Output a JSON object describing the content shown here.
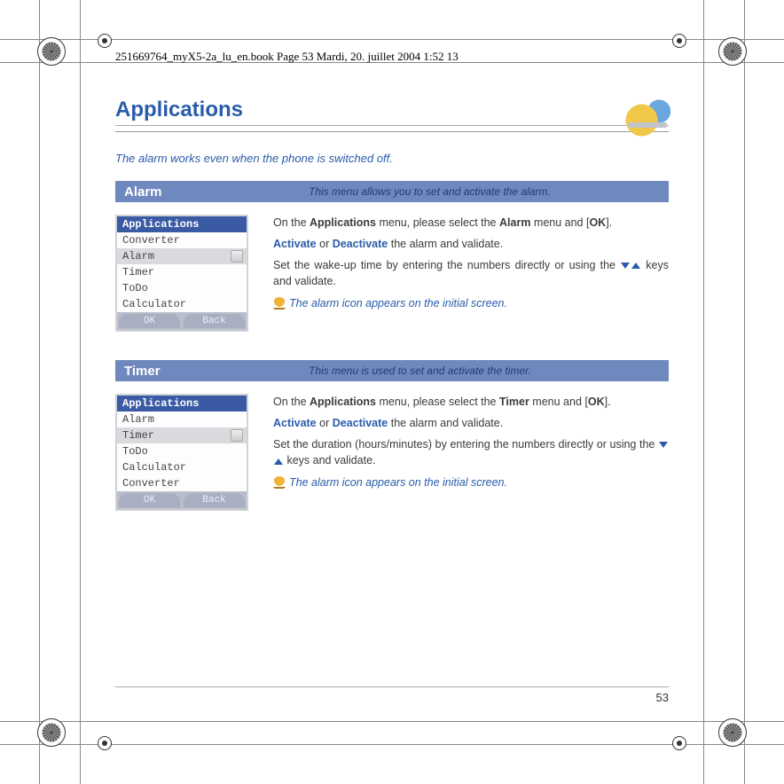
{
  "book_stamp": "251669764_myX5-2a_lu_en.book  Page 53  Mardi, 20. juillet 2004  1:52 13",
  "title": "Applications",
  "intro": "The alarm works even when the phone is switched off.",
  "page_number": "53",
  "sections": [
    {
      "name": "Alarm",
      "desc": "This menu allows you to set and activate the alarm.",
      "phone": {
        "title": "Applications",
        "items": [
          "Converter",
          "Alarm",
          "Timer",
          "ToDo",
          "Calculator"
        ],
        "selected": "Alarm",
        "softkeys": [
          "OK",
          "Back"
        ]
      },
      "para1_a": "On the ",
      "para1_b": "Applications",
      "para1_c": " menu, please select the ",
      "para1_d": "Alarm",
      "para1_e": " menu and [",
      "para1_f": "OK",
      "para1_g": "].",
      "para2_a": "Activate",
      "para2_b": " or ",
      "para2_c": "Deactivate",
      "para2_d": " the alarm and validate.",
      "para3_a": "Set the wake-up time by entering the numbers directly or using the ",
      "para3_b": " keys and validate.",
      "note": "The alarm icon appears on the initial screen."
    },
    {
      "name": "Timer",
      "desc": "This menu is used to set and activate the timer.",
      "phone": {
        "title": "Applications",
        "items": [
          "Alarm",
          "Timer",
          "ToDo",
          "Calculator",
          "Converter"
        ],
        "selected": "Timer",
        "softkeys": [
          "OK",
          "Back"
        ]
      },
      "para1_a": "On the ",
      "para1_b": "Applications",
      "para1_c": " menu, please select the ",
      "para1_d": "Timer",
      "para1_e": " menu and [",
      "para1_f": "OK",
      "para1_g": "].",
      "para2_a": "Activate",
      "para2_b": " or ",
      "para2_c": "Deactivate",
      "para2_d": " the alarm and validate.",
      "para3_a": "Set the duration (hours/minutes) by entering the numbers directly or using the ",
      "para3_b": " keys and validate.",
      "note": "The alarm icon appears on the initial screen."
    }
  ]
}
